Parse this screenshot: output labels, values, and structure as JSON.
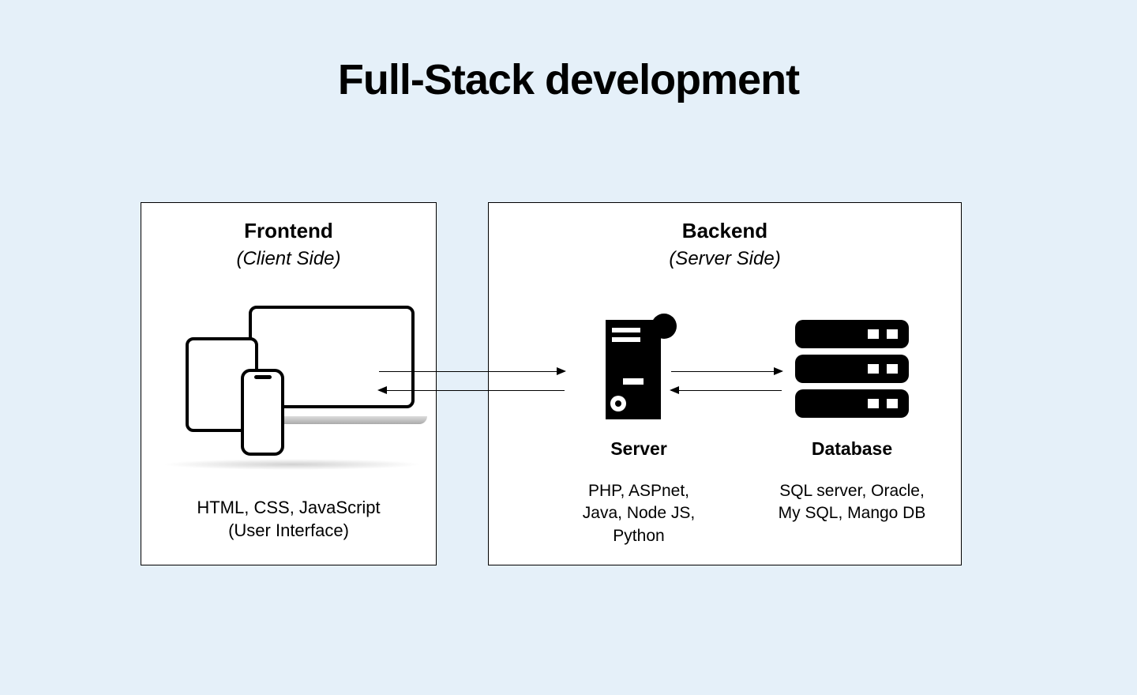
{
  "title": "Full-Stack development",
  "frontend": {
    "title": "Frontend",
    "subtitle": "(Client Side)",
    "tech_line1": "HTML, CSS, JavaScript",
    "tech_line2": "(User Interface)"
  },
  "backend": {
    "title": "Backend",
    "subtitle": "(Server Side)",
    "server": {
      "label": "Server",
      "tech_line1": "PHP, ASPnet,",
      "tech_line2": "Java, Node JS,",
      "tech_line3": "Python"
    },
    "database": {
      "label": "Database",
      "tech_line1": "SQL server, Oracle,",
      "tech_line2": "My SQL, Mango DB"
    }
  }
}
